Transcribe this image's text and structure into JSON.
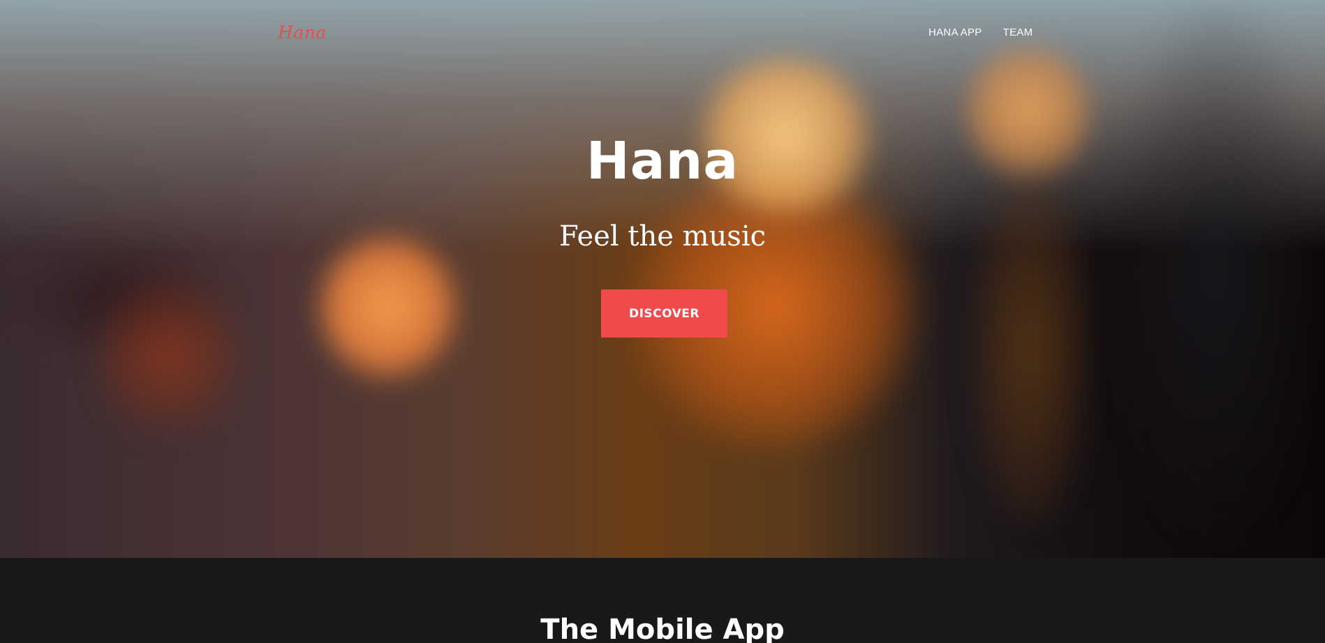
{
  "nav": {
    "logo": "Hana",
    "links": [
      "HANA APP",
      "TEAM"
    ]
  },
  "hero": {
    "title": "Hana",
    "subtitle": "Feel the music",
    "cta_label": "DISCOVER"
  },
  "section": {
    "title": "The Mobile App"
  },
  "colors": {
    "accent": "#ef4b4c",
    "section_background": "#19181a",
    "text": "#ffffff"
  }
}
